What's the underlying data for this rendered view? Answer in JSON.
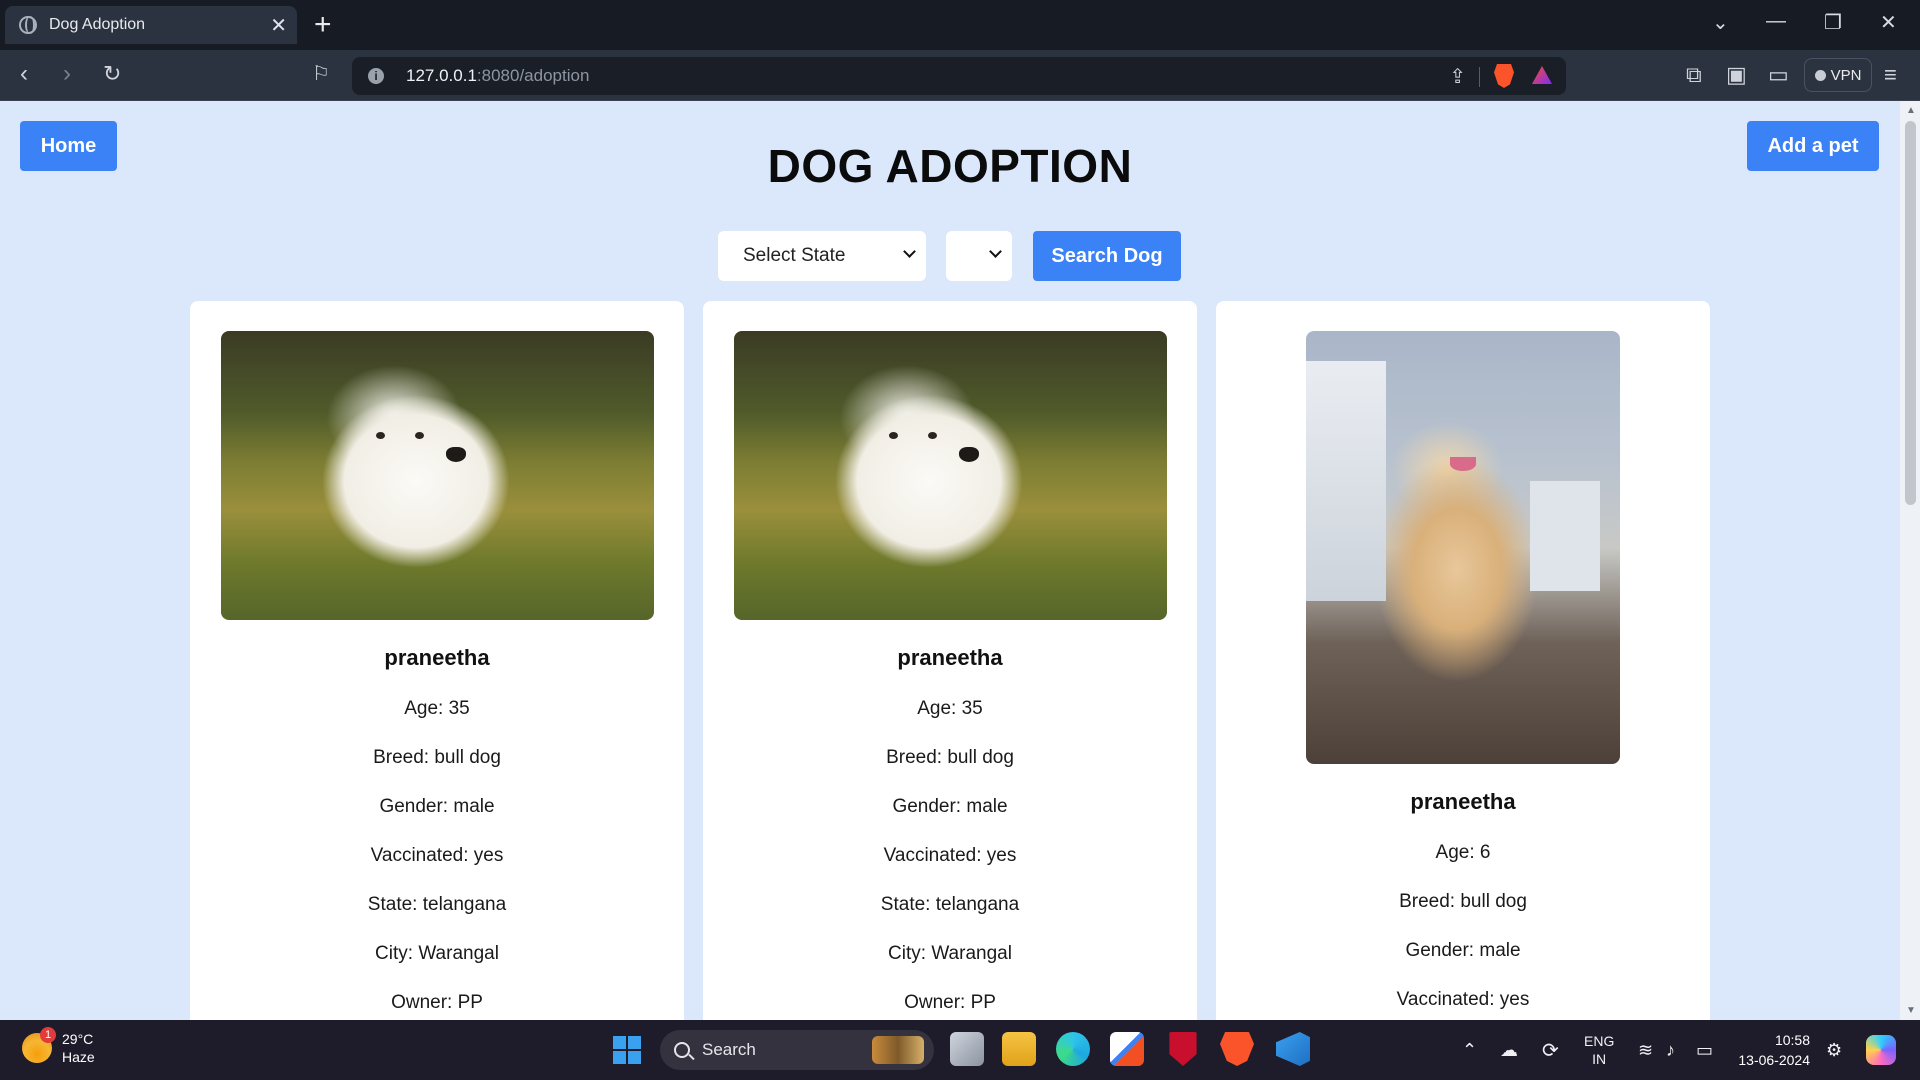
{
  "browser": {
    "tab_title": "Dog Adoption",
    "tab_close": "✕",
    "new_tab": "+",
    "url_host": "127.0.0.1",
    "url_path": ":8080/adoption",
    "vpn_label": "VPN"
  },
  "page": {
    "home_label": "Home",
    "add_pet_label": "Add a pet",
    "title": "DOG ADOPTION",
    "state_select_value": "Select State",
    "city_select_value": "",
    "search_label": "Search Dog"
  },
  "dogs": [
    {
      "name": "praneetha",
      "age": "Age: 35",
      "breed": "Breed: bull dog",
      "gender": "Gender: male",
      "vaccinated": "Vaccinated: yes",
      "state": "State: telangana",
      "city": "City: Warangal",
      "owner": "Owner: PP",
      "photo_icon": "white-fluffy-dog-photo"
    },
    {
      "name": "praneetha",
      "age": "Age: 35",
      "breed": "Breed: bull dog",
      "gender": "Gender: male",
      "vaccinated": "Vaccinated: yes",
      "state": "State: telangana",
      "city": "City: Warangal",
      "owner": "Owner: PP",
      "photo_icon": "white-fluffy-dog-photo"
    },
    {
      "name": "praneetha",
      "age": "Age: 6",
      "breed": "Breed: bull dog",
      "gender": "Gender: male",
      "vaccinated": "Vaccinated: yes",
      "photo_icon": "shih-tzu-dog-photo"
    }
  ],
  "taskbar": {
    "weather_temp": "29°C",
    "weather_desc": "Haze",
    "weather_badge": "1",
    "search_label": "Search",
    "lang_top": "ENG",
    "lang_bottom": "IN",
    "time": "10:58",
    "date": "13-06-2024"
  },
  "colors": {
    "page_bg": "#dbe8fb",
    "accent_button": "#3b82f6",
    "card_bg": "#ffffff"
  }
}
